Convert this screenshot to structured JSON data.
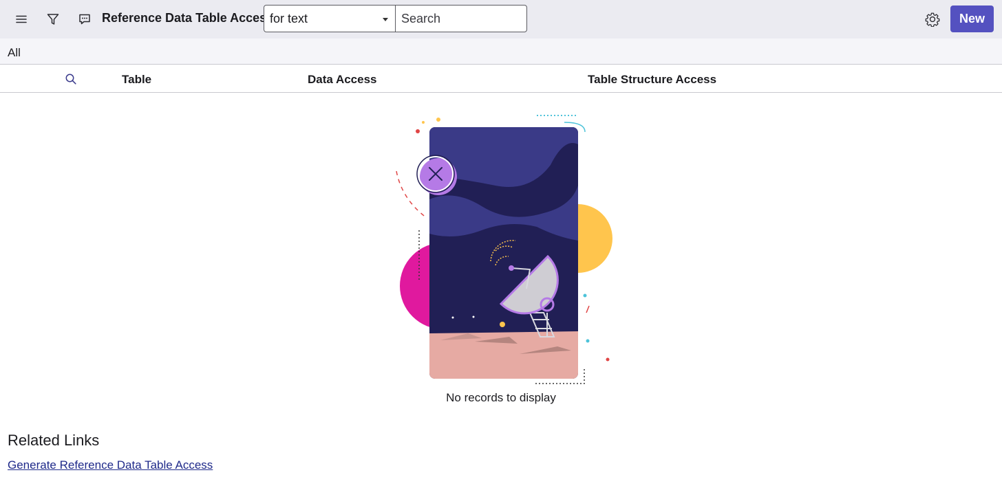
{
  "toolbar": {
    "title": "Reference Data Table Access",
    "field_select": "for text",
    "search_placeholder": "Search",
    "new_label": "New",
    "icons": [
      "hamburger-menu-icon",
      "filter-icon",
      "chat-bubble-icon",
      "gear-icon"
    ],
    "accent_color": "#5451c0"
  },
  "breadcrumb": {
    "label": "All"
  },
  "table": {
    "columns": [
      "Table",
      "Data Access",
      "Table Structure Access"
    ]
  },
  "empty_state": {
    "message": "No records to display"
  },
  "related": {
    "title": "Related Links",
    "links": [
      "Generate Reference Data Table Access"
    ]
  }
}
